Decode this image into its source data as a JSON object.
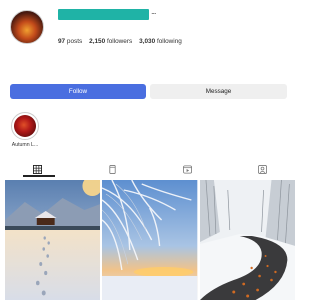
{
  "profile": {
    "more_label": "...",
    "stats": [
      {
        "value": "97",
        "label": "posts"
      },
      {
        "value": "2,150",
        "label": "followers"
      },
      {
        "value": "3,030",
        "label": "following"
      }
    ]
  },
  "actions": {
    "follow_label": "Follow",
    "message_label": "Message"
  },
  "highlights": [
    {
      "label": "Autumn L..."
    }
  ],
  "tabs": [
    "grid-icon",
    "reels-icon",
    "video-icon",
    "tagged-icon"
  ],
  "colors": {
    "follow_button": "#4a6ee0",
    "username_redaction": "#1fb3a6"
  }
}
